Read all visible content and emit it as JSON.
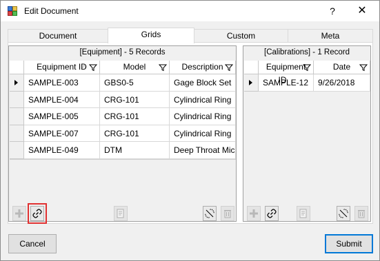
{
  "window": {
    "title": "Edit Document",
    "help_label": "?",
    "close_label": "✕"
  },
  "tabs": [
    {
      "label": "Document"
    },
    {
      "label": "Grids"
    },
    {
      "label": "Custom"
    },
    {
      "label": "Meta"
    }
  ],
  "equipment_grid": {
    "title": "[Equipment] - 5 Records",
    "columns": [
      "Equipment ID",
      "Model",
      "Description"
    ],
    "rows": [
      [
        "SAMPLE-003",
        "GBS0-5",
        "Gage Block Set"
      ],
      [
        "SAMPLE-004",
        "CRG-101",
        "Cylindrical Ring"
      ],
      [
        "SAMPLE-005",
        "CRG-101",
        "Cylindrical Ring"
      ],
      [
        "SAMPLE-007",
        "CRG-101",
        "Cylindrical Ring"
      ],
      [
        "SAMPLE-049",
        "DTM",
        "Deep Throat Mic"
      ]
    ]
  },
  "calibrations_grid": {
    "title": "[Calibrations] - 1 Record",
    "columns": [
      "Equipment ID",
      "Date"
    ],
    "rows": [
      [
        "SAMPLE-12",
        "9/26/2018"
      ]
    ]
  },
  "buttons": {
    "cancel": "Cancel",
    "submit": "Submit"
  },
  "colors": {
    "accent": "#0078d7",
    "highlight": "#e03030"
  }
}
